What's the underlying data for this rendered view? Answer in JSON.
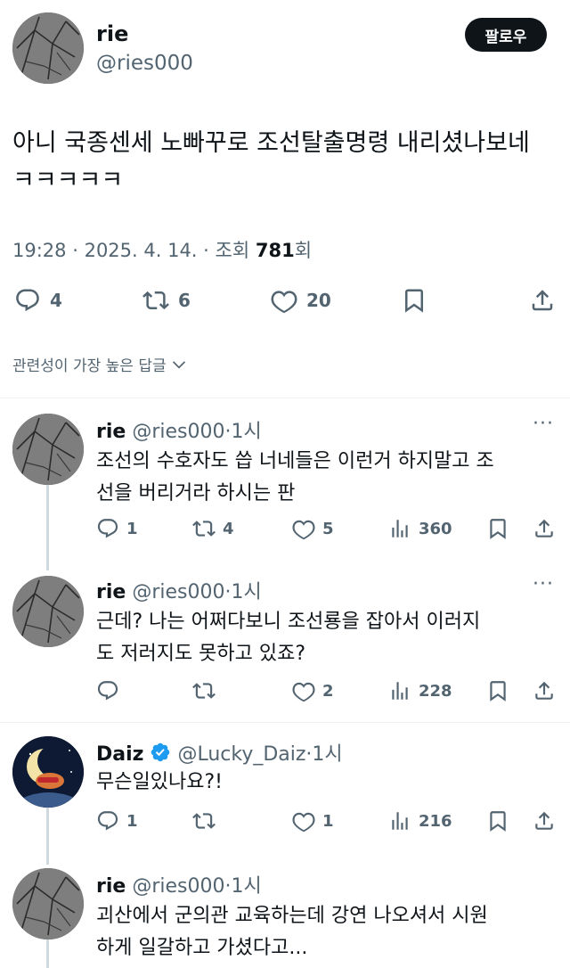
{
  "main_tweet": {
    "author_name": "rie",
    "author_handle": "@ries000",
    "follow_label": "팔로우",
    "text_line1": "아니 국종센세 노빠꾸로 조선탈출명령 내리셨나보네",
    "text_line2": "ㅋㅋㅋㅋㅋ",
    "time": "19:28",
    "date": "2025. 4. 14.",
    "views_prefix": "조회",
    "views_count": "781",
    "views_suffix": "회",
    "replies": "4",
    "retweets": "6",
    "likes": "20"
  },
  "sort_label": "관련성이 가장 높은 답글",
  "replies": [
    {
      "name": "rie",
      "handle": "@ries000",
      "time": "1시",
      "line1": "조선의 수호자도 씁 너네들은 이런거 하지말고 조",
      "line2": "선을 버리거라 하시는 판",
      "replies": "1",
      "retweets": "4",
      "likes": "5",
      "views": "360"
    },
    {
      "name": "rie",
      "handle": "@ries000",
      "time": "1시",
      "line1": "근데? 나는 어쩌다보니 조선룡을 잡아서 이러지",
      "line2": "도 저러지도 못하고 있죠?",
      "likes": "2",
      "views": "228"
    },
    {
      "name": "Daiz",
      "handle": "@Lucky_Daiz",
      "time": "1시",
      "line1": "무슨일있나요?!",
      "replies": "1",
      "likes": "1",
      "views": "216"
    },
    {
      "name": "rie",
      "handle": "@ries000",
      "time": "1시",
      "line1": "괴산에서 군의관 교육하는데 강연 나오셔서 시원",
      "line2": "하게 일갈하고 가셨다고..."
    }
  ],
  "colors": {
    "text": "#0f1419",
    "muted": "#536471",
    "verified": "#1d9bf0",
    "divider": "#eff3f4"
  }
}
